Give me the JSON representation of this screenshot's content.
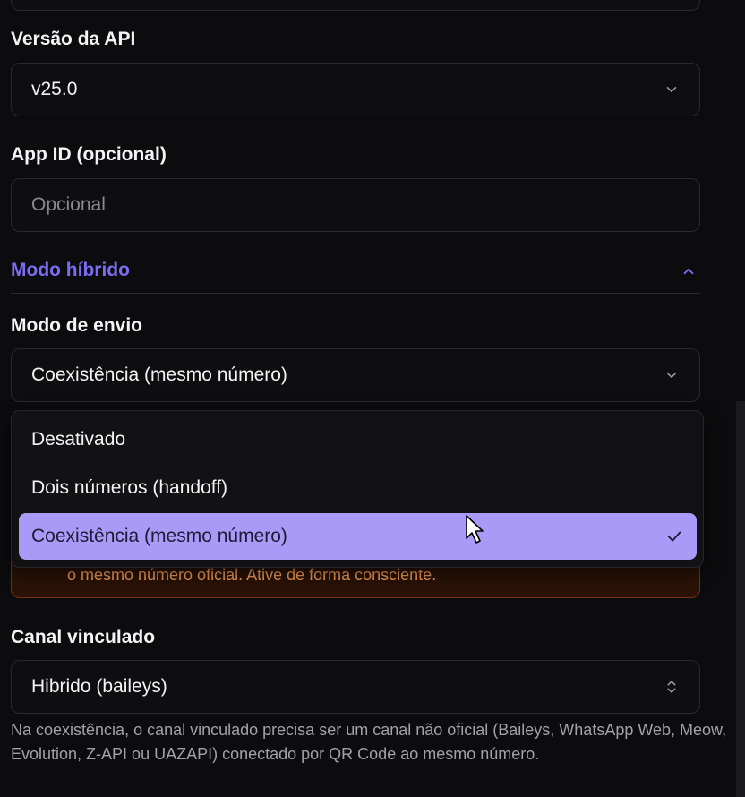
{
  "api_version": {
    "label": "Versão da API",
    "value": "v25.0"
  },
  "app_id": {
    "label": "App ID (opcional)",
    "placeholder": "Opcional"
  },
  "hybrid_section": {
    "title": "Modo híbrido"
  },
  "send_mode": {
    "label": "Modo de envio",
    "value": "Coexistência (mesmo número)",
    "options": [
      "Desativado",
      "Dois números (handoff)",
      "Coexistência (mesmo número)"
    ]
  },
  "warning": {
    "visible_text": "o mesmo número oficial. Ative de forma consciente."
  },
  "linked_channel": {
    "label": "Canal vinculado",
    "value": "Hibrido (baileys)",
    "help": "Na coexistência, o canal vinculado precisa ser um canal não oficial (Baileys, WhatsApp Web, Meow, Evolution, Z-API ou UAZAPI) conectado por QR Code ao mesmo número."
  },
  "colors": {
    "background": "#0c0c0e",
    "accent": "#7c6cf2",
    "selected_option": "#a99af7",
    "warning_border": "#7c2d12",
    "warning_text": "#f59e5b"
  },
  "icons": [
    "chevron-down-icon",
    "chevron-up-icon",
    "check-icon",
    "chevron-up-down-icon",
    "mouse-pointer-icon"
  ]
}
